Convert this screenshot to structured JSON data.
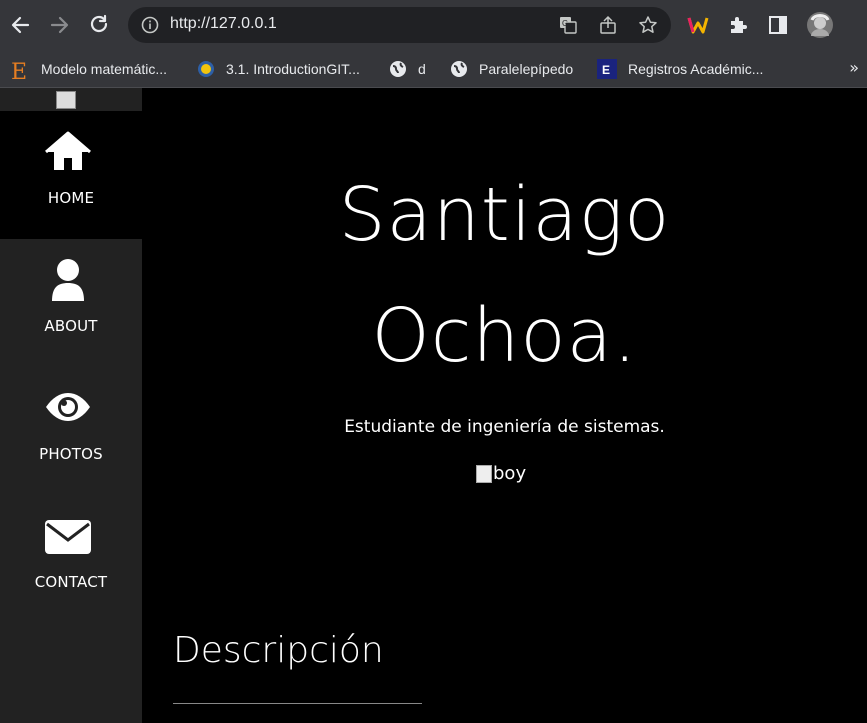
{
  "browser": {
    "url": "http://127.0.0.1",
    "bookmarks": [
      {
        "label": "Modelo matemátic..."
      },
      {
        "label": "3.1. IntroductionGIT..."
      },
      {
        "label": "d"
      },
      {
        "label": "Paralelepípedo"
      },
      {
        "label": "Registros Académic..."
      }
    ],
    "more": "»"
  },
  "sidebar": {
    "items": [
      {
        "label": "HOME",
        "icon": "home-icon"
      },
      {
        "label": "ABOUT",
        "icon": "user-icon"
      },
      {
        "label": "PHOTOS",
        "icon": "eye-icon"
      },
      {
        "label": "CONTACT",
        "icon": "envelope-icon"
      }
    ]
  },
  "hero": {
    "first_name": "Santiago",
    "last_name": "Ochoa.",
    "subtitle": "Estudiante de ingeniería de sistemas.",
    "image_alt": "boy"
  },
  "description": {
    "title": "Descripción"
  },
  "colors": {
    "sidebar_bg": "#222222",
    "active_bg": "#000000",
    "page_bg": "#000000",
    "chrome_bg": "#35363a"
  }
}
